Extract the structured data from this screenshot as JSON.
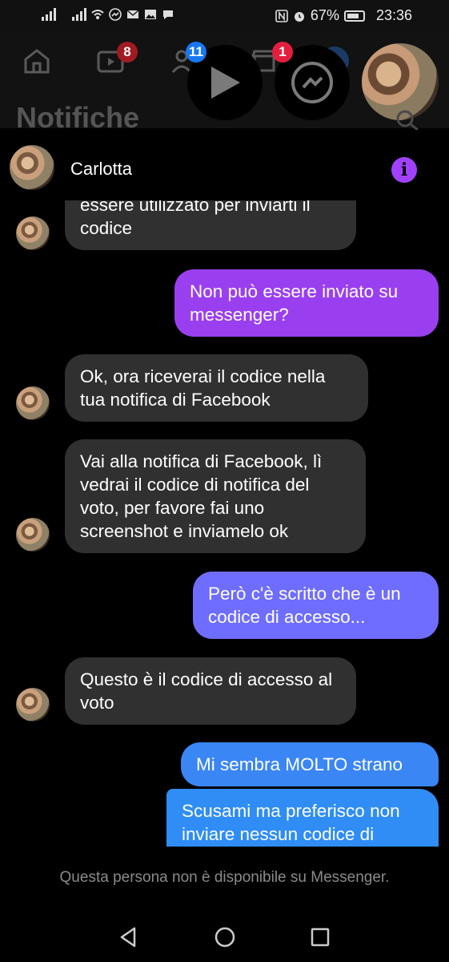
{
  "status_bar": {
    "battery": "67%",
    "time": "23:36"
  },
  "facebook_header": {
    "title": "Notifiche",
    "badges": {
      "video": "8",
      "chat_heads_play": "11",
      "chat_heads_messenger": "1"
    }
  },
  "chat": {
    "contact_name": "Carlotta",
    "messages": [
      {
        "from": "them",
        "text": "essere utilizzato per inviarti il codice"
      },
      {
        "from": "me",
        "text": "Non può essere inviato su messenger?"
      },
      {
        "from": "them",
        "text": "Ok, ora riceverai il codice nella tua notifica di Facebook"
      },
      {
        "from": "them",
        "text": "Vai alla notifica di Facebook, lì vedrai il codice di notifica del voto, per favore fai uno screenshot e inviamelo ok"
      },
      {
        "from": "me",
        "text": "Però c'è scritto che è un codice di accesso..."
      },
      {
        "from": "them",
        "text": "Questo è il codice di accesso al voto"
      },
      {
        "from": "me",
        "text": "Mi sembra MOLTO strano"
      },
      {
        "from": "me",
        "text": "Scusami ma preferisco non inviare nessun codice di"
      }
    ],
    "footer_note": "Questa persona non è disponibile su Messenger."
  },
  "colors": {
    "accent": "#a141ff",
    "outgoing_top": "#9a3ff0",
    "outgoing_mid": "#6f6dff",
    "outgoing_bottom": "#2f8df5",
    "incoming": "#303030"
  }
}
